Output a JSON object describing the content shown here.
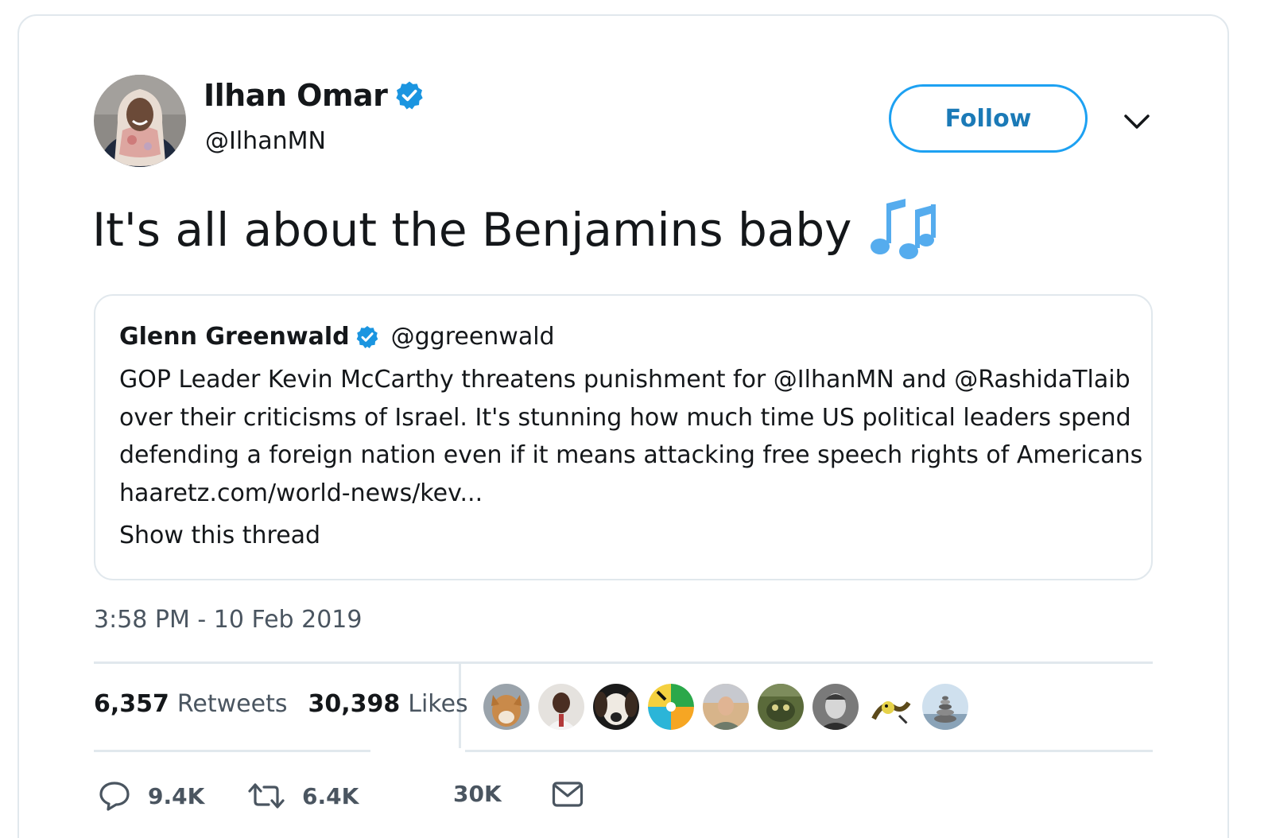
{
  "author": {
    "name": "Ilhan Omar",
    "handle": "@IlhanMN",
    "verified": true
  },
  "follow_label": "Follow",
  "tweet": {
    "text": "It's all about the Benjamins baby",
    "emoji": "musical-notes-icon"
  },
  "quoted": {
    "name": "Glenn Greenwald",
    "handle": "@ggreenwald",
    "lines": [
      "GOP Leader Kevin McCarthy threatens punishment for @IlhanMN and @RashidaTlaib",
      "over their criticisms of Israel. It's stunning how much time US political leaders spend",
      "defending a foreign nation even if it means attacking free speech rights of Americans",
      "haaretz.com/world-news/kev..."
    ],
    "thread_link": "Show this thread"
  },
  "timestamp": "3:58 PM - 10 Feb 2019",
  "stats": {
    "retweets_count": "6,357",
    "retweets_label": "Retweets",
    "likes_count": "30,398",
    "likes_label": "Likes"
  },
  "actions": {
    "replies": "9.4K",
    "retweets": "6.4K",
    "likes": "30K"
  },
  "colors": {
    "accent": "#1da1f2",
    "verified": "#1b95e0",
    "follow_text": "#1b7ab7",
    "notes": "#55acee",
    "border": "#e1e8ed"
  }
}
